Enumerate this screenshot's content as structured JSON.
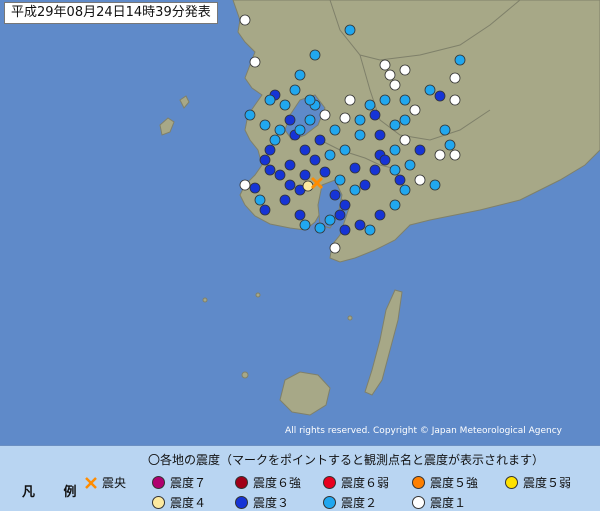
{
  "title": "平成29年08月24日14時39分発表",
  "copyright": "All rights reserved. Copyright © Japan Meteorological Agency",
  "legend": {
    "heading": "凡 例",
    "caption": "〇各地の震度（マークをポイントすると観測点名と震度が表示されます）",
    "epicenter_label": "震央",
    "items": [
      {
        "label": "震度７",
        "color": "#b0006f"
      },
      {
        "label": "震度６強",
        "color": "#a10018"
      },
      {
        "label": "震度６弱",
        "color": "#e8001e"
      },
      {
        "label": "震度５強",
        "color": "#ff7f00"
      },
      {
        "label": "震度５弱",
        "color": "#ffe100"
      },
      {
        "label": "震度４",
        "color": "#fdeaa0"
      },
      {
        "label": "震度３",
        "color": "#1634d6"
      },
      {
        "label": "震度２",
        "color": "#21a7ef"
      },
      {
        "label": "震度１",
        "color": "#ffffff"
      }
    ]
  },
  "colors": {
    "sea": "#5f8ac9",
    "land": "#a7a887",
    "land_edge": "#7f806a",
    "epicenter": "#ff8c00"
  }
}
